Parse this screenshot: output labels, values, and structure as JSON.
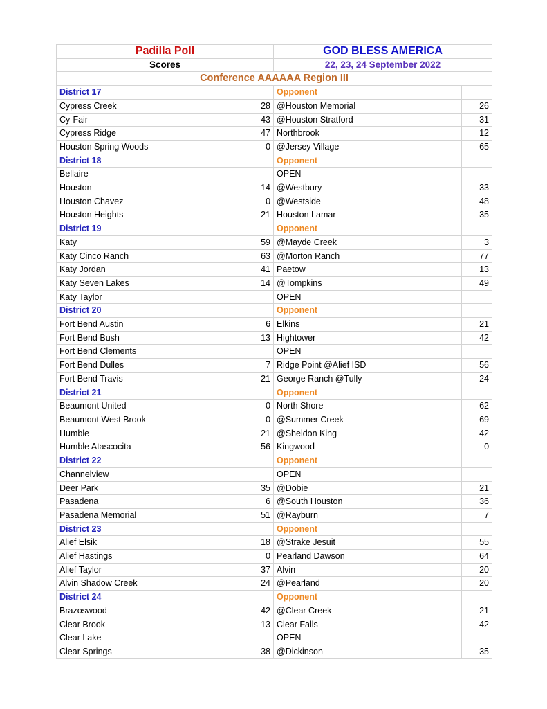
{
  "header": {
    "left_title": "Padilla Poll",
    "left_subtitle": "Scores",
    "right_title": "GOD BLESS AMERICA",
    "right_subtitle": "22, 23, 24 September 2022",
    "conference": "Conference AAAAAA Region III",
    "opponent_column_label": "Opponent",
    "colors": {
      "left_title": "#cc1111",
      "right_title": "#1414cc",
      "right_subtitle": "#5a33bb",
      "conference": "#c06a2a",
      "district": "#2222bb",
      "opponent_label": "#ee8822"
    }
  },
  "districts": [
    {
      "name": "District 17",
      "games": [
        {
          "team": "Cypress Creek",
          "score": "28",
          "opponent": "@Houston Memorial",
          "opponent_score": "26"
        },
        {
          "team": "Cy-Fair",
          "score": "43",
          "opponent": "@Houston Stratford",
          "opponent_score": "31"
        },
        {
          "team": "Cypress Ridge",
          "score": "47",
          "opponent": "Northbrook",
          "opponent_score": "12"
        },
        {
          "team": "Houston Spring Woods",
          "score": "0",
          "opponent": "@Jersey Village",
          "opponent_score": "65"
        }
      ]
    },
    {
      "name": "District 18",
      "games": [
        {
          "team": "Bellaire",
          "score": "",
          "opponent": "OPEN",
          "opponent_score": ""
        },
        {
          "team": "Houston",
          "score": "14",
          "opponent": "@Westbury",
          "opponent_score": "33"
        },
        {
          "team": "Houston Chavez",
          "score": "0",
          "opponent": "@Westside",
          "opponent_score": "48"
        },
        {
          "team": "Houston Heights",
          "score": "21",
          "opponent": "Houston Lamar",
          "opponent_score": "35"
        }
      ]
    },
    {
      "name": "District 19",
      "games": [
        {
          "team": "Katy",
          "score": "59",
          "opponent": "@Mayde Creek",
          "opponent_score": "3"
        },
        {
          "team": "Katy Cinco Ranch",
          "score": "63",
          "opponent": "@Morton Ranch",
          "opponent_score": "77"
        },
        {
          "team": "Katy Jordan",
          "score": "41",
          "opponent": "Paetow",
          "opponent_score": "13"
        },
        {
          "team": "Katy Seven Lakes",
          "score": "14",
          "opponent": "@Tompkins",
          "opponent_score": "49"
        },
        {
          "team": "Katy Taylor",
          "score": "",
          "opponent": "OPEN",
          "opponent_score": ""
        }
      ]
    },
    {
      "name": "District 20",
      "games": [
        {
          "team": "Fort Bend Austin",
          "score": "6",
          "opponent": "Elkins",
          "opponent_score": "21"
        },
        {
          "team": "Fort Bend Bush",
          "score": "13",
          "opponent": "Hightower",
          "opponent_score": "42"
        },
        {
          "team": "Fort Bend Clements",
          "score": "",
          "opponent": "OPEN",
          "opponent_score": ""
        },
        {
          "team": "Fort Bend Dulles",
          "score": "7",
          "opponent": "Ridge Point @Alief ISD",
          "opponent_score": "56"
        },
        {
          "team": "Fort Bend Travis",
          "score": "21",
          "opponent": "George Ranch @Tully",
          "opponent_score": "24"
        }
      ]
    },
    {
      "name": "District 21",
      "games": [
        {
          "team": "Beaumont United",
          "score": "0",
          "opponent": "North Shore",
          "opponent_score": "62"
        },
        {
          "team": "Beaumont West Brook",
          "score": "0",
          "opponent": "@Summer Creek",
          "opponent_score": "69"
        },
        {
          "team": "Humble",
          "score": "21",
          "opponent": "@Sheldon King",
          "opponent_score": "42"
        },
        {
          "team": "Humble Atascocita",
          "score": "56",
          "opponent": "Kingwood",
          "opponent_score": "0"
        }
      ]
    },
    {
      "name": "District 22",
      "games": [
        {
          "team": "Channelview",
          "score": "",
          "opponent": "OPEN",
          "opponent_score": ""
        },
        {
          "team": "Deer Park",
          "score": "35",
          "opponent": "@Dobie",
          "opponent_score": "21"
        },
        {
          "team": "Pasadena",
          "score": "6",
          "opponent": "@South Houston",
          "opponent_score": "36"
        },
        {
          "team": "Pasadena Memorial",
          "score": "51",
          "opponent": "@Rayburn",
          "opponent_score": "7"
        }
      ]
    },
    {
      "name": "District 23",
      "games": [
        {
          "team": "Alief Elsik",
          "score": "18",
          "opponent": "@Strake Jesuit",
          "opponent_score": "55"
        },
        {
          "team": "Alief Hastings",
          "score": "0",
          "opponent": "Pearland Dawson",
          "opponent_score": "64"
        },
        {
          "team": "Alief Taylor",
          "score": "37",
          "opponent": "Alvin",
          "opponent_score": "20"
        },
        {
          "team": "Alvin Shadow Creek",
          "score": "24",
          "opponent": "@Pearland",
          "opponent_score": "20"
        }
      ]
    },
    {
      "name": "District 24",
      "games": [
        {
          "team": "Brazoswood",
          "score": "42",
          "opponent": "@Clear Creek",
          "opponent_score": "21"
        },
        {
          "team": "Clear Brook",
          "score": "13",
          "opponent": "Clear Falls",
          "opponent_score": "42"
        },
        {
          "team": "Clear Lake",
          "score": "",
          "opponent": "OPEN",
          "opponent_score": ""
        },
        {
          "team": "Clear Springs",
          "score": "38",
          "opponent": "@Dickinson",
          "opponent_score": "35"
        }
      ]
    }
  ]
}
